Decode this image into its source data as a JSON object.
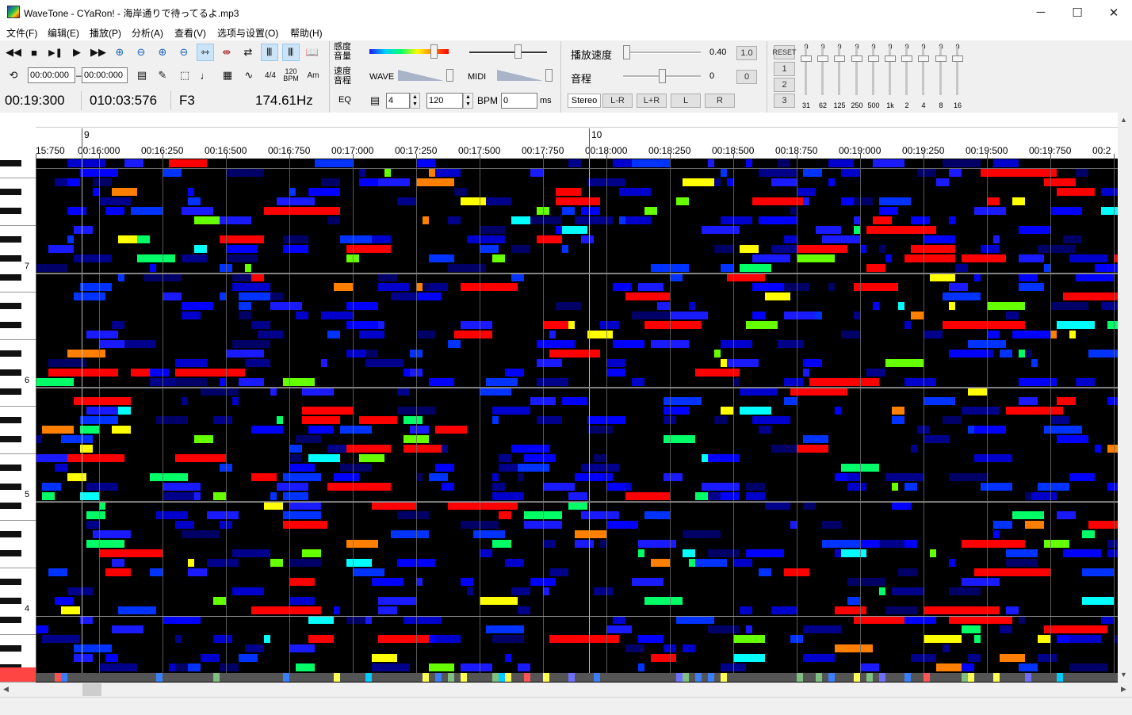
{
  "window": {
    "title": "WaveTone - CYaRon! - 海岸通りで待ってるよ.mp3",
    "minimize_glyph": "─",
    "maximize_glyph": "☐",
    "close_glyph": "✕"
  },
  "menu": [
    "文件(F)",
    "编辑(E)",
    "播放(P)",
    "分析(A)",
    "查看(V)",
    "选项与设置(O)",
    "帮助(H)"
  ],
  "toolbar": {
    "row1_icons": [
      "rewind-icon",
      "stop-icon",
      "pause-icon",
      "play-icon",
      "fast-forward-icon",
      "zoom-in-horizontal-icon",
      "zoom-out-horizontal-icon",
      "zoom-in-vertical-icon",
      "zoom-out-vertical-icon",
      "fit-horizontal-icon",
      "fit-vertical-icon",
      "swap-arrows-icon",
      "wave-view-icon",
      "wave-view-alt-icon",
      "book-icon"
    ],
    "row2_icons": [
      "loop-icon"
    ],
    "loop_start": "00:00:000",
    "loop_dash": "–",
    "loop_end": "00:00:000",
    "time_sig": "4/4",
    "bpm_icon_top": "120",
    "bpm_icon_bottom": "BPM",
    "key_icon": "Am"
  },
  "readout": {
    "time": "00:19:300",
    "measure": "010:03:576",
    "note": "F3",
    "freq": "174.61Hz",
    "eq_label": "EQ"
  },
  "levels": {
    "sens_top": "感度",
    "sens_bottom": "音量",
    "speed_top": "速度",
    "speed_bottom": "音程",
    "wave_label": "WAVE",
    "midi_label": "MIDI"
  },
  "tempo": {
    "beats": "4",
    "bpm": "120",
    "bpm_label": "BPM",
    "offset": "0",
    "ms_label": "ms"
  },
  "playback": {
    "speed_label": "播放速度",
    "speed_value": "0.40",
    "speed_reset": "1.0",
    "pitch_label": "音程",
    "pitch_value": "0",
    "pitch_reset": "0",
    "channel_buttons": [
      "Stereo",
      "L-R",
      "L+R",
      "L",
      "R"
    ]
  },
  "eq": {
    "buttons": [
      "RESET",
      "1",
      "2",
      "3"
    ],
    "bands": [
      "31",
      "62",
      "125",
      "250",
      "500",
      "1k",
      "2",
      "4",
      "8",
      "16"
    ],
    "band_tops": [
      "0",
      "0",
      "0",
      "0",
      "0",
      "0",
      "0",
      "0",
      "0",
      "0"
    ]
  },
  "ruler": {
    "measures": [
      {
        "label": "9",
        "time_s": 15.93
      },
      {
        "label": "10",
        "time_s": 17.93
      }
    ],
    "ticks": [
      "15:750",
      "00:16:000",
      "00:16:250",
      "00:16:500",
      "00:16:750",
      "00:17:000",
      "00:17:250",
      "00:17:500",
      "00:17:750",
      "00:18:000",
      "00:18:250",
      "00:18:500",
      "00:18:750",
      "00:19:000",
      "00:19:250",
      "00:19:500",
      "00:19:750",
      "00:2"
    ]
  },
  "keyboard": {
    "octave_labels": [
      "7",
      "6",
      "5",
      "4"
    ]
  },
  "colors": {
    "accent_red": "#ff0000",
    "accent_blue": "#0000ff",
    "grid_line": "#6e6e6e",
    "highlight_key": "#ff4444"
  },
  "spectrogram": {
    "seed": 7
  }
}
